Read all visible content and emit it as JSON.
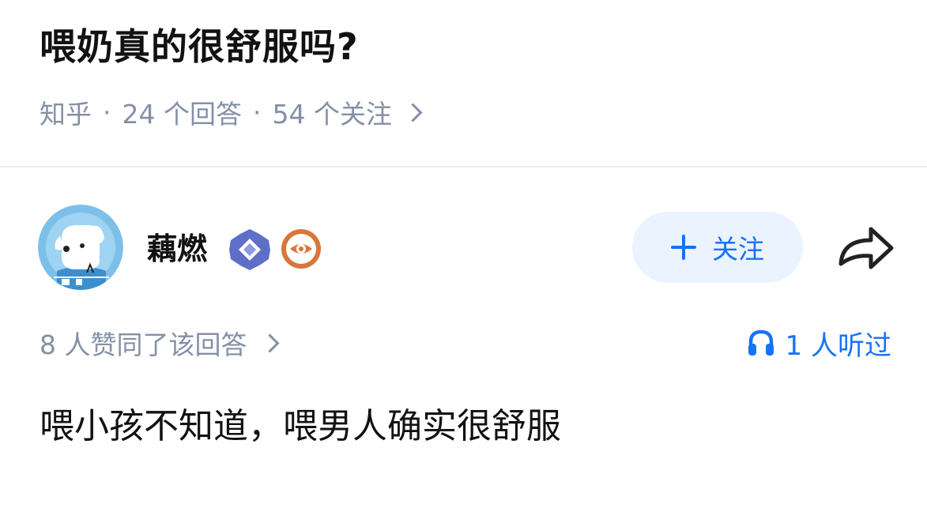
{
  "question": {
    "title": "喂奶真的很舒服吗?",
    "source": "知乎",
    "answers_count": "24 个回答",
    "followers_count": "54 个关注",
    "separator": "·"
  },
  "author": {
    "name": "藕燃",
    "follow_label": "关注",
    "badges": [
      "verified-diamond-icon",
      "eye-badge-icon"
    ]
  },
  "answer": {
    "vote_text": "8 人赞同了该回答",
    "listen_text": "1 人听过",
    "content": "喂小孩不知道，喂男人确实很舒服"
  },
  "colors": {
    "accent": "#1772f6",
    "follow_bg": "#ebf3fe",
    "meta_gray": "#8590a6",
    "text": "#121212"
  }
}
